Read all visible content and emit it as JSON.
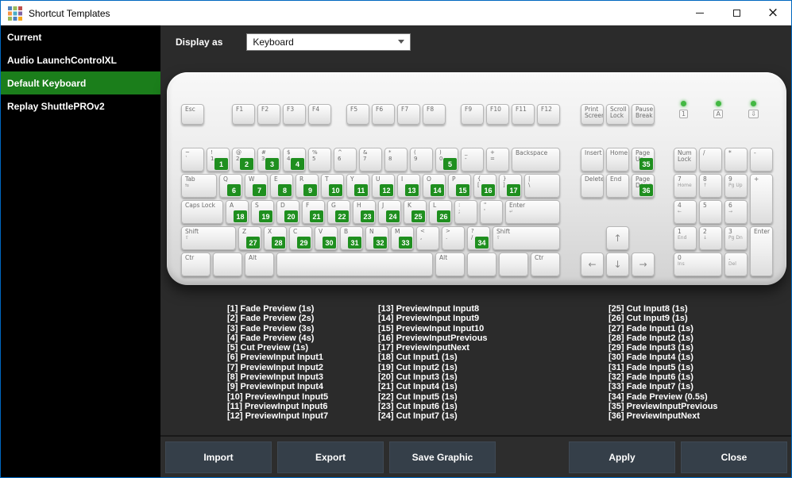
{
  "window": {
    "title": "Shortcut Templates"
  },
  "sidebar": {
    "items": [
      {
        "label": "Current",
        "selected": false
      },
      {
        "label": "Audio LaunchControlXL",
        "selected": false
      },
      {
        "label": "Default Keyboard",
        "selected": true
      },
      {
        "label": "Replay ShuttlePROv2",
        "selected": false
      }
    ]
  },
  "toolbar": {
    "display_as_label": "Display as",
    "display_as_value": "Keyboard"
  },
  "keyboard": {
    "main_rows": [
      [
        {
          "l": "Esc"
        },
        {
          "sp": 1
        },
        {
          "l": "F1"
        },
        {
          "l": "F2"
        },
        {
          "l": "F3"
        },
        {
          "l": "F4"
        },
        {
          "sp": 0.5
        },
        {
          "l": "F5"
        },
        {
          "l": "F6"
        },
        {
          "l": "F7"
        },
        {
          "l": "F8"
        },
        {
          "sp": 0.5
        },
        {
          "l": "F9"
        },
        {
          "l": "F10"
        },
        {
          "l": "F11"
        },
        {
          "l": "F12"
        }
      ],
      [
        {
          "t": "~",
          "l": "`"
        },
        {
          "t": "!",
          "l": "1",
          "b": 1
        },
        {
          "t": "@",
          "l": "2",
          "b": 2
        },
        {
          "t": "#",
          "l": "3",
          "b": 3
        },
        {
          "t": "$",
          "l": "4",
          "b": 4
        },
        {
          "t": "%",
          "l": "5"
        },
        {
          "t": "^",
          "l": "6"
        },
        {
          "t": "&",
          "l": "7"
        },
        {
          "t": "*",
          "l": "8"
        },
        {
          "t": "(",
          "l": "9"
        },
        {
          "t": ")",
          "l": "0",
          "b": 5
        },
        {
          "t": "_",
          "l": "-"
        },
        {
          "t": "+",
          "l": "="
        },
        {
          "l": "Backspace",
          "w": 2
        }
      ],
      [
        {
          "l": "Tab",
          "sub": "⇆",
          "w": 1.5
        },
        {
          "l": "Q",
          "b": 6
        },
        {
          "l": "W",
          "b": 7
        },
        {
          "l": "E",
          "b": 8
        },
        {
          "l": "R",
          "b": 9
        },
        {
          "l": "T",
          "b": 10
        },
        {
          "l": "Y",
          "b": 11
        },
        {
          "l": "U",
          "b": 12
        },
        {
          "l": "I",
          "b": 13
        },
        {
          "l": "O",
          "b": 14
        },
        {
          "l": "P",
          "b": 15
        },
        {
          "t": "{",
          "l": "[",
          "b": 16
        },
        {
          "t": "}",
          "l": "]",
          "b": 17
        },
        {
          "t": "|",
          "l": "\\",
          "w": 1.5
        }
      ],
      [
        {
          "l": "Caps Lock",
          "w": 1.75
        },
        {
          "l": "A",
          "b": 18
        },
        {
          "l": "S",
          "b": 19
        },
        {
          "l": "D",
          "b": 20
        },
        {
          "l": "F",
          "b": 21
        },
        {
          "l": "G",
          "b": 22
        },
        {
          "l": "H",
          "b": 23
        },
        {
          "l": "J",
          "b": 24
        },
        {
          "l": "K",
          "b": 25
        },
        {
          "l": "L",
          "b": 26
        },
        {
          "t": ":",
          "l": ";"
        },
        {
          "t": "\"",
          "l": "'"
        },
        {
          "l": "Enter",
          "sub": "↵",
          "w": 2.25
        }
      ],
      [
        {
          "l": "Shift",
          "sub": "⇧",
          "w": 2.25
        },
        {
          "l": "Z",
          "b": 27
        },
        {
          "l": "X",
          "b": 28
        },
        {
          "l": "C",
          "b": 29
        },
        {
          "l": "V",
          "b": 30
        },
        {
          "l": "B",
          "b": 31
        },
        {
          "l": "N",
          "b": 32
        },
        {
          "l": "M",
          "b": 33
        },
        {
          "t": "<",
          "l": ","
        },
        {
          "t": ">",
          "l": "."
        },
        {
          "t": "?",
          "l": "/",
          "b": 34
        },
        {
          "l": "Shift",
          "sub": "⇧",
          "w": 2.75
        }
      ],
      [
        {
          "l": "Ctr",
          "w": 1.25
        },
        {
          "l": "",
          "w": 1.25
        },
        {
          "l": "Alt",
          "w": 1.25
        },
        {
          "l": "",
          "w": 6.25
        },
        {
          "l": "Alt",
          "w": 1.25
        },
        {
          "l": "",
          "w": 1.25
        },
        {
          "l": "",
          "w": 1.25
        },
        {
          "l": "Ctr",
          "w": 1.25
        }
      ]
    ],
    "nav_top": [
      {
        "l": "Print Screen"
      },
      {
        "l": "Scroll Lock"
      },
      {
        "l": "Pause Break"
      }
    ],
    "nav_mid": [
      {
        "l": "Insert"
      },
      {
        "l": "Home"
      },
      {
        "l": "Page Up",
        "b": 35
      }
    ],
    "nav_bottom": [
      {
        "l": "Delete"
      },
      {
        "l": "End"
      },
      {
        "l": "Page Down",
        "b": 36
      }
    ],
    "arrow_up": [
      {
        "l": "↑",
        "cls": "arrow"
      }
    ],
    "arrows": [
      {
        "l": "←",
        "cls": "arrow"
      },
      {
        "l": "↓",
        "cls": "arrow"
      },
      {
        "l": "→",
        "cls": "arrow"
      }
    ],
    "numpad": [
      {
        "l": "Num Lock"
      },
      {
        "l": "/"
      },
      {
        "l": "*"
      },
      {
        "l": "-"
      },
      {
        "l": "7",
        "sub": "Home"
      },
      {
        "l": "8",
        "sub": "↑"
      },
      {
        "l": "9",
        "sub": "Pg Up"
      },
      {
        "l": "+",
        "rs": 2
      },
      {
        "l": "4",
        "sub": "←"
      },
      {
        "l": "5"
      },
      {
        "l": "6",
        "sub": "→"
      },
      {
        "l": "1",
        "sub": "End"
      },
      {
        "l": "2",
        "sub": "↓"
      },
      {
        "l": "3",
        "sub": "Pg Dn"
      },
      {
        "l": "Enter",
        "rs": 2
      },
      {
        "l": "0",
        "sub": "Ins",
        "cs": 2
      },
      {
        "l": ".",
        "sub": "Del"
      }
    ],
    "leds": [
      {
        "label": "1"
      },
      {
        "label": "A"
      },
      {
        "label": "⇩"
      }
    ]
  },
  "legend": {
    "columns": [
      [
        "[1] Fade Preview (1s)",
        "[2] Fade Preview (2s)",
        "[3] Fade Preview (3s)",
        "[4] Fade Preview (4s)",
        "[5] Cut Preview (1s)",
        "[6] PreviewInput Input1",
        "[7] PreviewInput Input2",
        "[8] PreviewInput Input3",
        "[9] PreviewInput Input4",
        "[10] PreviewInput Input5",
        "[11] PreviewInput Input6",
        "[12] PreviewInput Input7"
      ],
      [
        "[13] PreviewInput Input8",
        "[14] PreviewInput Input9",
        "[15] PreviewInput Input10",
        "[16] PreviewInputPrevious",
        "[17] PreviewInputNext",
        "[18] Cut Input1 (1s)",
        "[19] Cut Input2 (1s)",
        "[20] Cut Input3 (1s)",
        "[21] Cut Input4 (1s)",
        "[22] Cut Input5 (1s)",
        "[23] Cut Input6 (1s)",
        "[24] Cut Input7 (1s)"
      ],
      [
        "[25] Cut Input8 (1s)",
        "[26] Cut Input9 (1s)",
        "[27] Fade Input1 (1s)",
        "[28] Fade Input2 (1s)",
        "[29] Fade Input3 (1s)",
        "[30] Fade Input4 (1s)",
        "[31] Fade Input5 (1s)",
        "[32] Fade Input6 (1s)",
        "[33] Fade Input7 (1s)",
        "[34] Fade Preview (0.5s)",
        "[35] PreviewInputPrevious",
        "[36] PreviewInputNext"
      ]
    ]
  },
  "footer": {
    "left_buttons": [
      "Import",
      "Export",
      "Save Graphic"
    ],
    "right_buttons": [
      "Apply",
      "Close"
    ]
  },
  "colors": {
    "selection_green": "#1b7e1b",
    "badge_green": "#1f8f1f",
    "led_green": "#43b843",
    "accent_border": "#0067c0"
  }
}
